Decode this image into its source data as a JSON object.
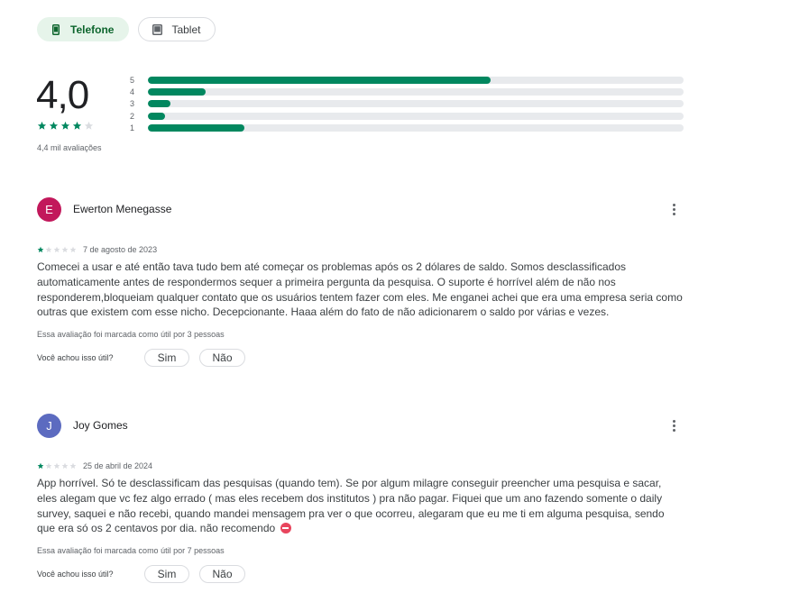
{
  "device_tabs": [
    {
      "label": "Telefone",
      "icon": "phone-icon",
      "selected": true
    },
    {
      "label": "Tablet",
      "icon": "tablet-icon",
      "selected": false
    }
  ],
  "summary": {
    "rating": "4,0",
    "stars_filled": 4,
    "stars_total": 5,
    "count_label": "4,4 mil avaliações"
  },
  "histogram": [
    {
      "label": "5",
      "fraction": 0.64
    },
    {
      "label": "4",
      "fraction": 0.107
    },
    {
      "label": "3",
      "fraction": 0.042
    },
    {
      "label": "2",
      "fraction": 0.032
    },
    {
      "label": "1",
      "fraction": 0.18
    }
  ],
  "colors": {
    "accent": "#01875f",
    "star_empty": "#dadce0"
  },
  "reviews": [
    {
      "initial": "E",
      "avatar_color": "#c2185b",
      "name": "Ewerton Menegasse",
      "stars": 1,
      "date": "7 de agosto de 2023",
      "text": "Comecei a usar e até então tava tudo bem até começar os problemas após os 2 dólares de saldo. Somos desclassificados automaticamente antes de respondermos sequer a primeira pergunta da pesquisa. O suporte é horrível além de não nos responderem,bloqueiam qualquer contato que os usuários tentem fazer com eles. Me enganei achei que era uma empresa seria como outras que existem com esse nicho. Decepcionante. Haaa além do fato de não adicionarem o saldo por várias e vezes.",
      "useful": "Essa avaliação foi marcada como útil por 3 pessoas",
      "ask": "Você achou isso útil?",
      "yes": "Sim",
      "no": "Não"
    },
    {
      "initial": "J",
      "avatar_color": "#5c6bc0",
      "name": "Joy Gomes",
      "stars": 1,
      "date": "25 de abril de 2024",
      "text": "App horrível. Só te desclassificam das pesquisas (quando tem). Se por algum milagre conseguir preencher uma pesquisa e sacar, eles alegam que vc fez algo errado ( mas eles recebem dos institutos ) pra não pagar. Fiquei que um ano fazendo somente o daily survey, saquei e não recebi, quando mandei mensagem pra ver o que ocorreu, alegaram que eu me ti em alguma pesquisa, sendo que era só os 2 centavos por dia. não recomendo",
      "emoji": "no-entry-icon",
      "useful": "Essa avaliação foi marcada como útil por 7 pessoas",
      "ask": "Você achou isso útil?",
      "yes": "Sim",
      "no": "Não"
    }
  ]
}
